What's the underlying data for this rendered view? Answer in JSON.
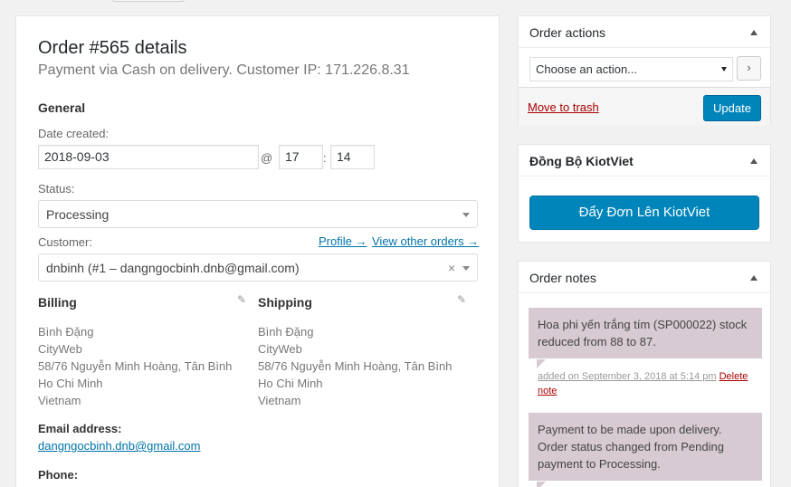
{
  "order": {
    "title": "Order #565 details",
    "subtitle": "Payment via Cash on delivery. Customer IP: 171.226.8.31",
    "general_heading": "General",
    "date_label": "Date created:",
    "date_value": "2018-09-03",
    "at_sign": "@",
    "hour": "17",
    "colon": ":",
    "minute": "14",
    "status_label": "Status:",
    "status_value": "Processing",
    "customer_label": "Customer:",
    "profile_link": "Profile →",
    "other_orders_link": "View other orders →",
    "customer_value": "dnbinh (#1 – dangngocbinh.dnb@gmail.com)",
    "clear_symbol": "×"
  },
  "billing": {
    "heading": "Billing",
    "lines": [
      "Bình Đặng",
      "CityWeb",
      "58/76 Nguyễn Minh Hoàng, Tân Bình",
      "Ho Chi Minh",
      "Vietnam"
    ],
    "email_label": "Email address:",
    "email": "dangngocbinh.dnb@gmail.com",
    "phone_label": "Phone:"
  },
  "shipping": {
    "heading": "Shipping",
    "lines": [
      "Bình Đặng",
      "CityWeb",
      "58/76 Nguyễn Minh Hoàng, Tân Bình",
      "Ho Chi Minh",
      "Vietnam"
    ]
  },
  "order_actions": {
    "heading": "Order actions",
    "select_value": "Choose an action...",
    "go_label": "›",
    "trash_label": "Move to trash",
    "update_label": "Update"
  },
  "kiotviet": {
    "heading": "Đồng Bộ KiotViet",
    "button_label": "Đẩy Đơn Lên KiotViet"
  },
  "notes": {
    "heading": "Order notes",
    "items": [
      {
        "text": "Hoa phi yến trắng tím (SP000022) stock reduced from 88 to 87.",
        "meta": "added on September 3, 2018 at 5:14 pm",
        "delete": "Delete note"
      },
      {
        "text": "Payment to be made upon delivery. Order status changed from Pending payment to Processing."
      }
    ]
  },
  "colors": {
    "primary": "#0085ba",
    "link": "#0073aa",
    "danger": "#a00",
    "note_bg": "#d7cad2"
  }
}
